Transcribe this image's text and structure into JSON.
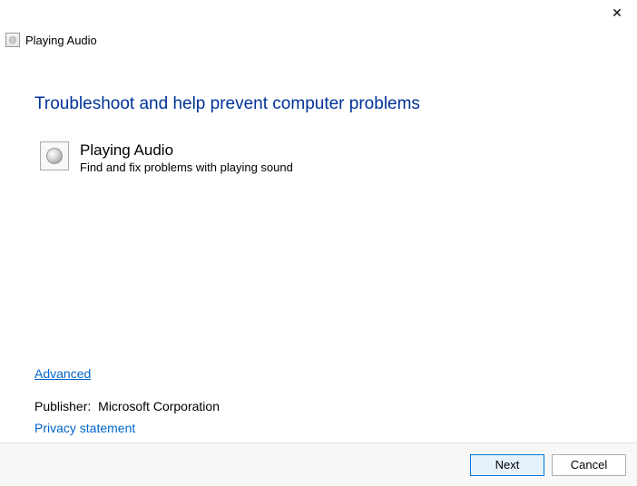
{
  "window": {
    "title": "Playing Audio"
  },
  "main": {
    "heading": "Troubleshoot and help prevent computer problems",
    "item": {
      "title": "Playing Audio",
      "description": "Find and fix problems with playing sound"
    },
    "advanced_link": "Advanced",
    "publisher_label": "Publisher:",
    "publisher_value": "Microsoft Corporation",
    "privacy_link": "Privacy statement"
  },
  "footer": {
    "next": "Next",
    "cancel": "Cancel"
  }
}
